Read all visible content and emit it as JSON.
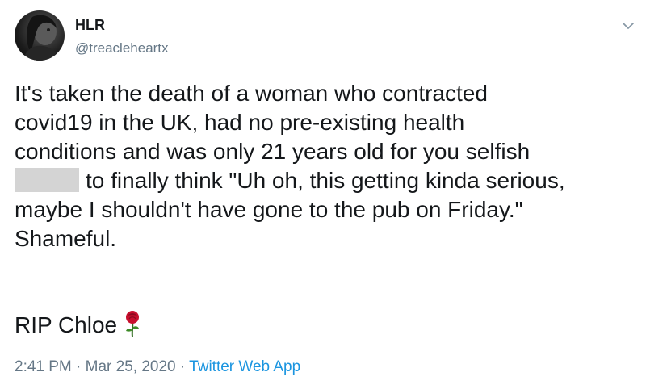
{
  "user": {
    "display_name": "HLR",
    "handle": "@treacleheartx"
  },
  "tweet": {
    "lines": [
      "It's taken the death of a woman who contracted",
      "covid19 in the UK, had no pre-existing health",
      "conditions and was only 21 years old for you selfish",
      "to finally think \"Uh oh, this getting kinda serious,",
      "maybe I shouldn't have gone to the pub on Friday.\"",
      "Shameful."
    ],
    "sign_off": "RIP Chloe",
    "emoji": "rose-emoji"
  },
  "meta": {
    "time": "2:41 PM",
    "separator": "·",
    "date": "Mar 25, 2020",
    "source": "Twitter Web App"
  },
  "icons": {
    "more": "chevron-down-icon"
  },
  "colors": {
    "text": "#14171a",
    "secondary": "#657786",
    "link": "#1b95e0",
    "redaction": "#d4d4d4"
  }
}
